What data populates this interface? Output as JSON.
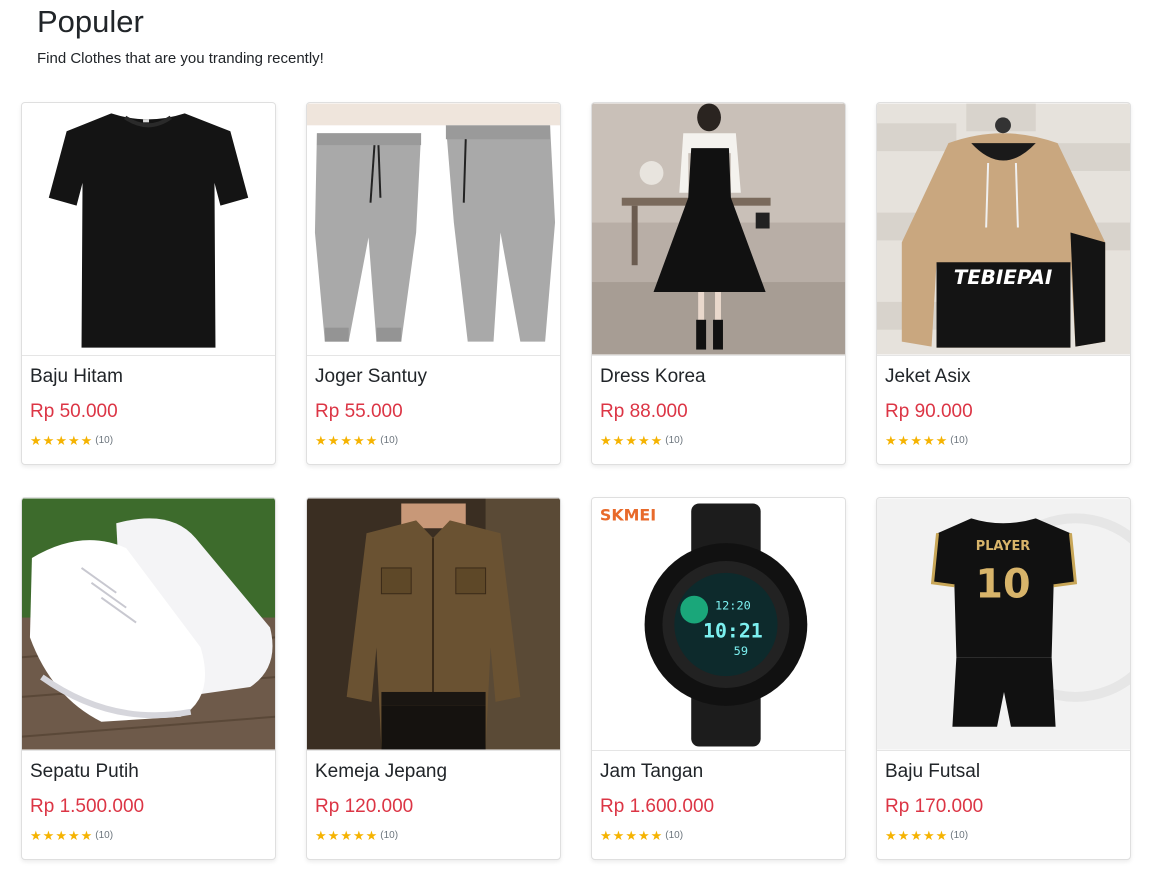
{
  "section": {
    "title": "Populer",
    "subtitle": "Find Clothes that are you tranding recently!"
  },
  "products": [
    {
      "name": "Baju Hitam",
      "price": "Rp 50.000",
      "rating_count": "(10)",
      "stars": 5,
      "image": "black-tshirt"
    },
    {
      "name": "Joger Santuy",
      "price": "Rp 55.000",
      "rating_count": "(10)",
      "stars": 5,
      "image": "grey-jogger-pants"
    },
    {
      "name": "Dress Korea",
      "price": "Rp 88.000",
      "rating_count": "(10)",
      "stars": 5,
      "image": "black-dress"
    },
    {
      "name": "Jeket Asix",
      "price": "Rp 90.000",
      "rating_count": "(10)",
      "stars": 5,
      "image": "hoodie-jacket"
    },
    {
      "name": "Sepatu Putih",
      "price": "Rp 1.500.000",
      "rating_count": "(10)",
      "stars": 5,
      "image": "white-sneakers"
    },
    {
      "name": "Kemeja Jepang",
      "price": "Rp 120.000",
      "rating_count": "(10)",
      "stars": 5,
      "image": "brown-shirt"
    },
    {
      "name": "Jam Tangan",
      "price": "Rp 1.600.000",
      "rating_count": "(10)",
      "stars": 5,
      "image": "sport-watch"
    },
    {
      "name": "Baju Futsal",
      "price": "Rp 170.000",
      "rating_count": "(10)",
      "stars": 5,
      "image": "futsal-jersey"
    }
  ],
  "image_text": {
    "hoodie": "TEBIEPAI",
    "watch_brand": "SKMEI",
    "watch_time": "10:21",
    "watch_secs": "59",
    "watch_top": "12:20",
    "jersey_name": "PLAYER",
    "jersey_number": "10"
  },
  "colors": {
    "price": "#dc3545",
    "star": "#f5b301"
  }
}
